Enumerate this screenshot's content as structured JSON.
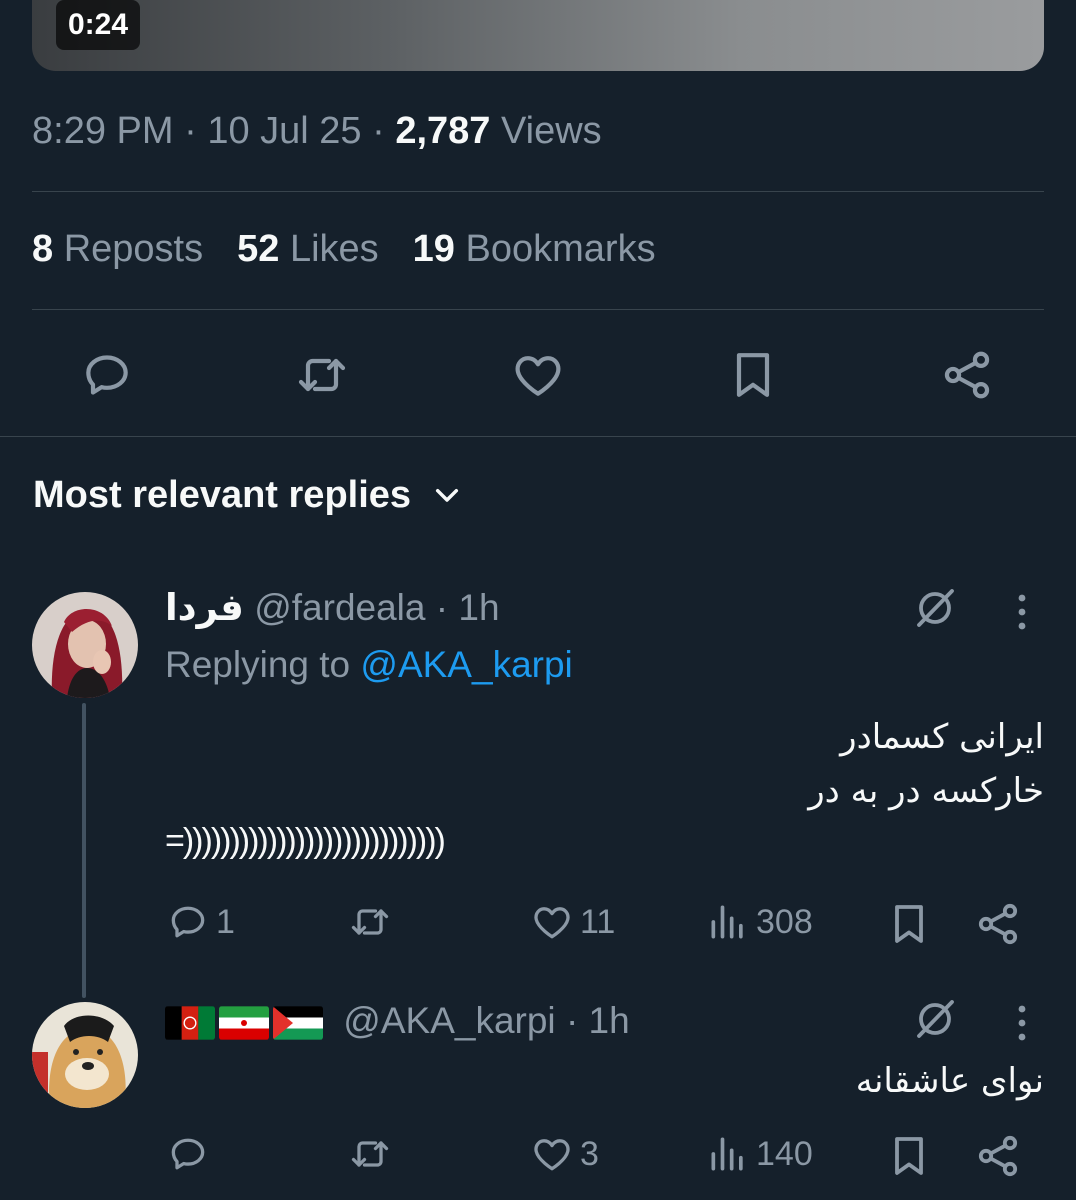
{
  "video": {
    "duration": "0:24"
  },
  "tweet": {
    "time": "8:29 PM",
    "date": "10 Jul 25",
    "views_count": "2,787",
    "views_label": "Views",
    "reposts_count": "8",
    "reposts_label": "Reposts",
    "likes_count": "52",
    "likes_label": "Likes",
    "bookmarks_count": "19",
    "bookmarks_label": "Bookmarks"
  },
  "replies_header": {
    "label": "Most relevant replies"
  },
  "replies": [
    {
      "name": "فردا",
      "handle": "@fardeala",
      "age": "1h",
      "replying_prefix": "Replying to",
      "replying_handle": "@AKA_karpi",
      "line1": "ایرانی کسمادر",
      "line2": "خارکسه در به در",
      "line3": "=))))))))))))))))))))))))))))",
      "replies_count": "1",
      "likes_count": "11",
      "views_count": "308"
    },
    {
      "flags": [
        "afghanistan-flag",
        "iran-flag",
        "palestine-flag"
      ],
      "handle": "@AKA_karpi",
      "age": "1h",
      "line1": "نوای عاشقانه",
      "likes_count": "3",
      "views_count": "140"
    }
  ],
  "colors": {
    "background": "#15202b",
    "secondary_text": "#8b98a5",
    "link": "#1d9bf0",
    "divider": "#38444d"
  }
}
